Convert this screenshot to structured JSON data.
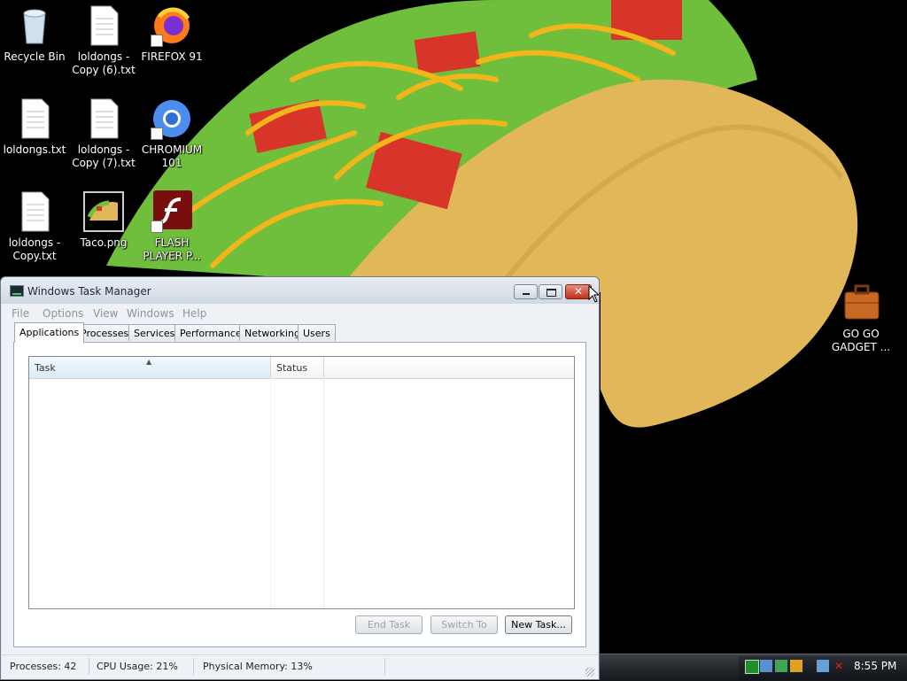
{
  "desktop": {
    "icons": [
      {
        "label": "Recycle Bin"
      },
      {
        "label": "loldongs - Copy (6).txt"
      },
      {
        "label": "FIREFOX 91"
      },
      {
        "label": "loldongs.txt"
      },
      {
        "label": "loldongs - Copy (7).txt"
      },
      {
        "label": "CHROMIUM 101"
      },
      {
        "label": "loldongs - Copy.txt"
      },
      {
        "label": "Taco.png"
      },
      {
        "label": "FLASH PLAYER P..."
      },
      {
        "label": "GO GO GADGET ..."
      }
    ]
  },
  "task_manager": {
    "title": "Windows Task Manager",
    "menu": [
      "File",
      "Options",
      "View",
      "Windows",
      "Help"
    ],
    "tabs": [
      "Applications",
      "Processes",
      "Services",
      "Performance",
      "Networking",
      "Users"
    ],
    "active_tab": "Applications",
    "columns": [
      "Task",
      "Status"
    ],
    "buttons": {
      "end_task": "End Task",
      "switch_to": "Switch To",
      "new_task": "New Task..."
    },
    "status": {
      "processes": "Processes: 42",
      "cpu": "CPU Usage: 21%",
      "memory": "Physical Memory: 13%"
    }
  },
  "taskbar": {
    "clock": "8:55 PM"
  },
  "colors": {
    "titlebar": "#dfe6ee",
    "close_button": "#c0301b",
    "taco_shell": "#e1b75a",
    "lettuce": "#6fbf3c",
    "tomato": "#d8352a",
    "cheese": "#f2b51a"
  }
}
